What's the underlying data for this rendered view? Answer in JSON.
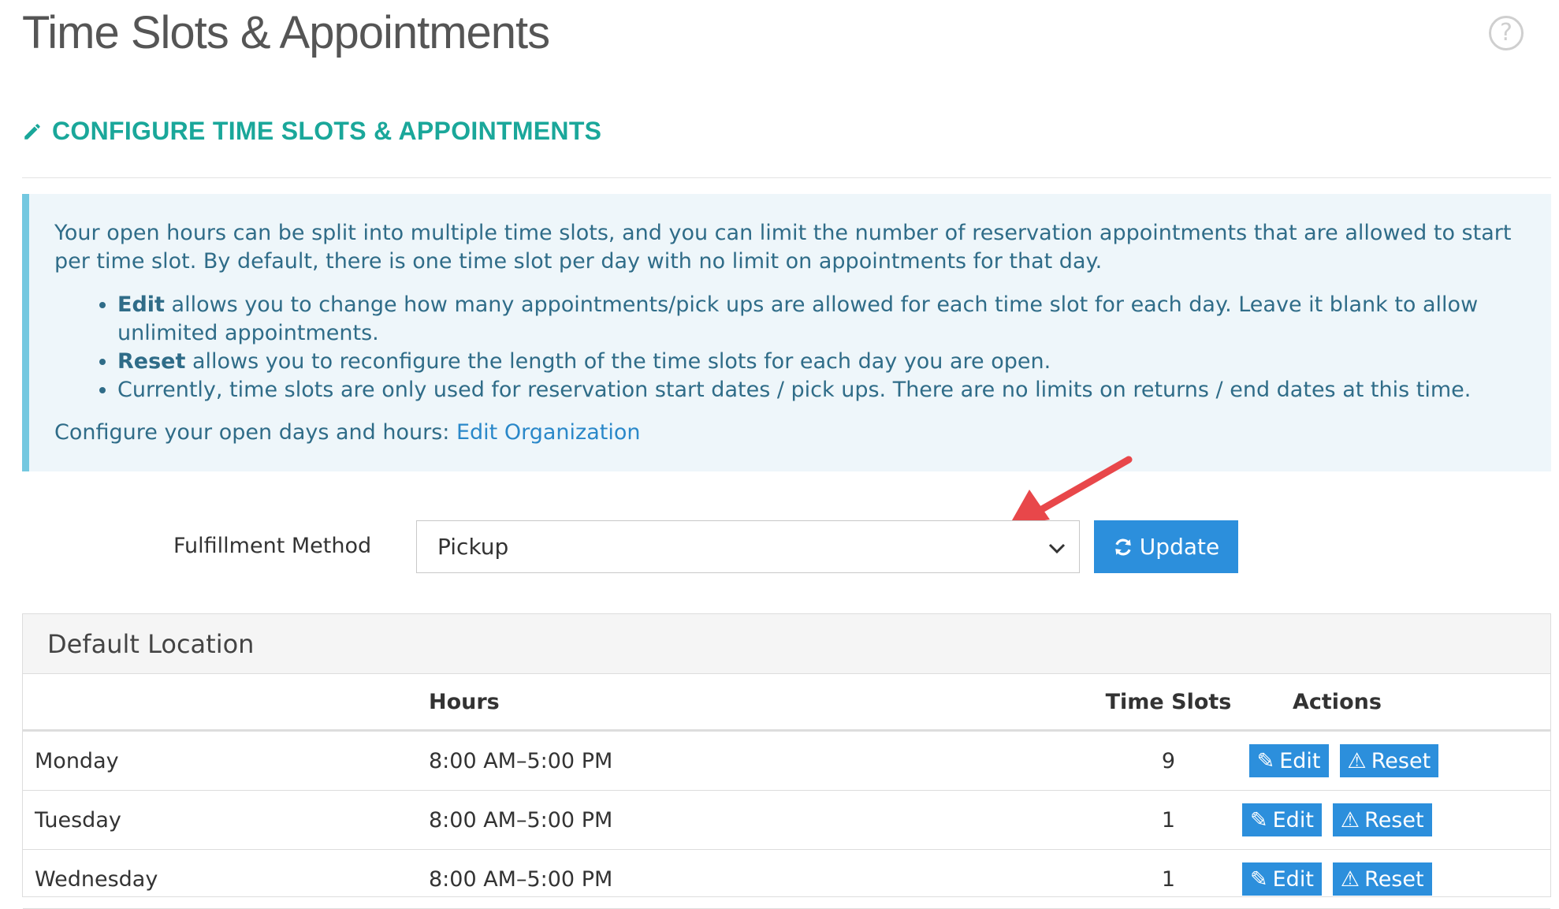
{
  "page": {
    "title": "Time Slots & Appointments",
    "help_icon": "question-circle-icon"
  },
  "section": {
    "title": "CONFIGURE TIME SLOTS & APPOINTMENTS",
    "icon": "pencil-icon"
  },
  "info": {
    "intro": "Your open hours can be split into multiple time slots, and you can limit the number of reservation appointments that are allowed to start per time slot. By default, there is one time slot per day with no limit on appointments for that day.",
    "bullets": [
      {
        "bold": "Edit",
        "text": " allows you to change how many appointments/pick ups are allowed for each time slot for each day. Leave it blank to allow unlimited appointments."
      },
      {
        "bold": "Reset",
        "text": " allows you to reconfigure the length of the time slots for each day you are open."
      },
      {
        "bold": "",
        "text": "Currently, time slots are only used for reservation start dates / pick ups. There are no limits on returns / end dates at this time."
      }
    ],
    "config_prefix": "Configure your open days and hours: ",
    "config_link": "Edit Organization"
  },
  "form": {
    "fulfillment_label": "Fulfillment Method",
    "fulfillment_value": "Pickup",
    "update_label": "Update"
  },
  "panel": {
    "title": "Default Location",
    "columns": {
      "day": "",
      "hours": "Hours",
      "slots": "Time Slots",
      "actions": "Actions"
    },
    "rows": [
      {
        "day": "Monday",
        "hours": "8:00 AM–5:00 PM",
        "slots": "9"
      },
      {
        "day": "Tuesday",
        "hours": "8:00 AM–5:00 PM",
        "slots": "1"
      },
      {
        "day": "Wednesday",
        "hours": "8:00 AM–5:00 PM",
        "slots": "1"
      }
    ],
    "edit_label": "Edit",
    "reset_label": "Reset"
  },
  "colors": {
    "accent": "#1aa79a",
    "primary_button": "#2c8fdc",
    "info_bg": "#eef6fa",
    "info_border": "#74c8e0",
    "annotation_arrow": "#e8474a"
  }
}
